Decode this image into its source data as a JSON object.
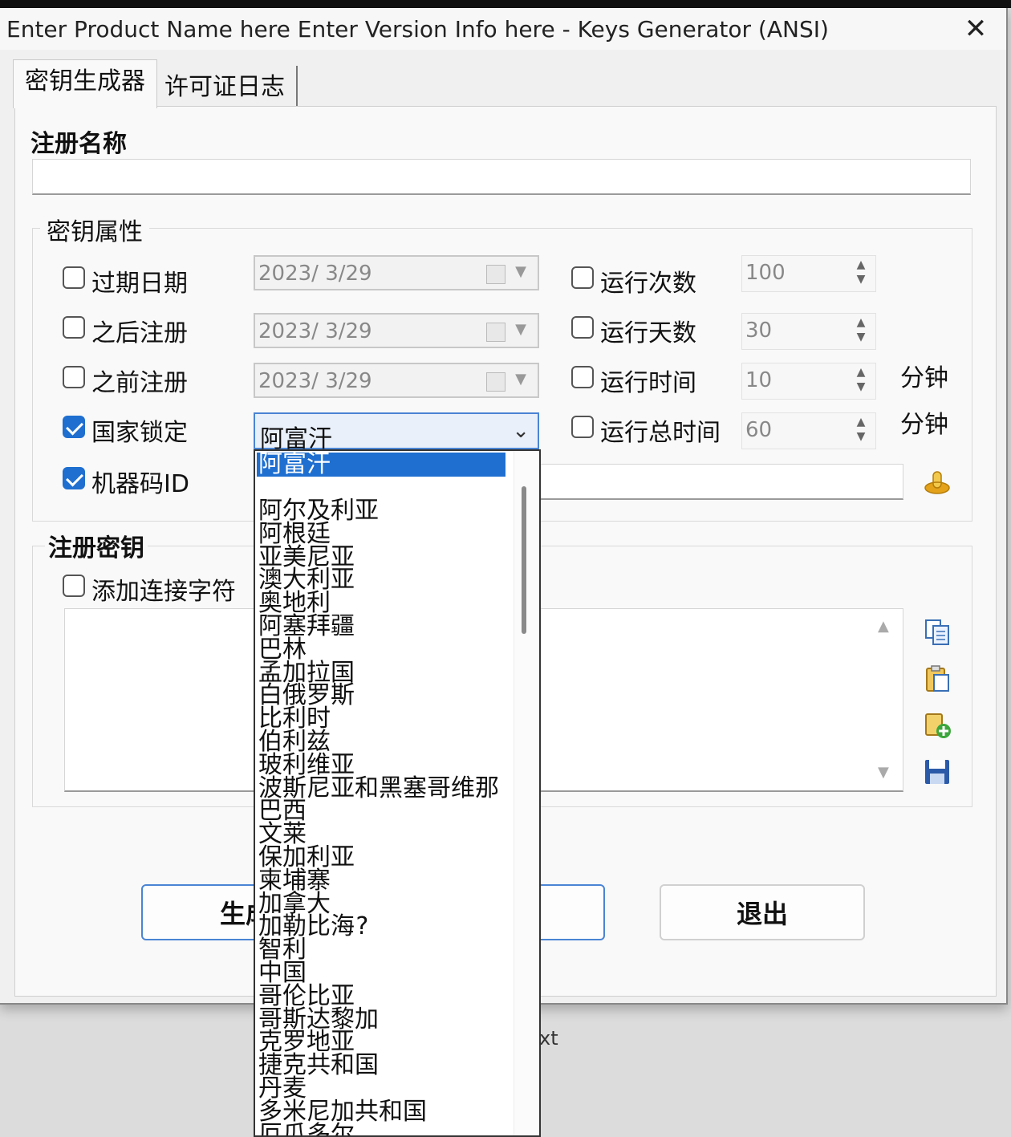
{
  "window": {
    "title": "Enter Product Name here Enter Version Info here - Keys Generator (ANSI)",
    "close_glyph": "✕"
  },
  "tabs": [
    {
      "label": "密钥生成器"
    },
    {
      "label": "许可证日志"
    }
  ],
  "registration_name": {
    "label": "注册名称",
    "value": ""
  },
  "key_properties": {
    "legend": "密钥属性",
    "rows": [
      {
        "label": "过期日期",
        "checked": false,
        "date": "2023/  3/29",
        "counter_label": "运行次数",
        "counter_checked": false,
        "counter_value": "100",
        "unit": ""
      },
      {
        "label": "之后注册",
        "checked": false,
        "date": "2023/  3/29",
        "counter_label": "运行天数",
        "counter_checked": false,
        "counter_value": "30",
        "unit": ""
      },
      {
        "label": "之前注册",
        "checked": false,
        "date": "2023/  3/29",
        "counter_label": "运行时间",
        "counter_checked": false,
        "counter_value": "10",
        "unit": "分钟"
      },
      {
        "label": "国家锁定",
        "checked": true,
        "counter_label": "运行总时间",
        "counter_checked": false,
        "counter_value": "60",
        "unit": "分钟"
      },
      {
        "label": "机器码ID",
        "checked": true
      }
    ],
    "country_selected": "阿富汗",
    "machine_id_value": ""
  },
  "registration_key": {
    "legend": "注册密钥",
    "add_separator_label": "添加连接字符",
    "add_separator_checked": false,
    "value": ""
  },
  "buttons": {
    "generate_partial": "生成",
    "exit": "退出"
  },
  "background_text": "xt",
  "country_dropdown": {
    "selected": "阿富汗",
    "items": [
      "阿尔及利亚",
      "阿根廷",
      "亚美尼亚",
      "澳大利亚",
      "奥地利",
      "阿塞拜疆",
      "巴林",
      "孟加拉国",
      "白俄罗斯",
      "比利时",
      "伯利兹",
      "玻利维亚",
      "波斯尼亚和黑塞哥维那",
      "巴西",
      "文莱",
      "保加利亚",
      "柬埔寨",
      "加拿大",
      "加勒比海?",
      "智利",
      "中国",
      "哥伦比亚",
      "哥斯达黎加",
      "克罗地亚",
      "捷克共和国",
      "丹麦",
      "多米尼加共和国",
      "厄瓜多尔"
    ]
  },
  "icons": {
    "machine_id": "fingerprint-icon",
    "copy": "copy-icon",
    "paste": "paste-icon",
    "add": "add-document-icon",
    "save": "save-icon"
  },
  "colors": {
    "accent": "#1e6fd0",
    "checkbox_checked": "#1e6fd0"
  }
}
